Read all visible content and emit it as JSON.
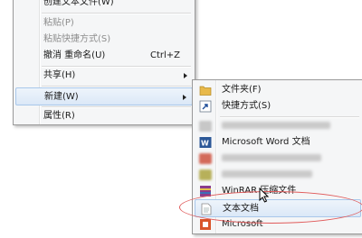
{
  "context_menu": {
    "items": [
      {
        "label": "创建文本文件(W)",
        "disabled": false
      },
      {
        "label": "粘贴(P)",
        "disabled": true
      },
      {
        "label": "粘贴快捷方式(S)",
        "disabled": true
      },
      {
        "label": "撤消 重命名(U)",
        "shortcut": "Ctrl+Z",
        "disabled": false
      },
      {
        "label": "共享(H)",
        "disabled": false
      },
      {
        "label": "新建(W)",
        "disabled": false
      },
      {
        "label": "属性(R)",
        "disabled": false
      }
    ]
  },
  "new_submenu": {
    "items": [
      {
        "label": "文件夹(F)",
        "icon": "folder-icon"
      },
      {
        "label": "快捷方式(S)",
        "icon": "shortcut-icon"
      },
      {
        "label": "Microsoft Word 文档",
        "icon": "word-icon"
      },
      {
        "label": "WinRAR 压缩文件",
        "icon": "winrar-icon"
      },
      {
        "label": "文本文档",
        "icon": "text-document-icon"
      },
      {
        "label": "Microsoft",
        "icon": "office-icon"
      }
    ]
  },
  "colors": {
    "highlight_border": "#a8c7ea",
    "annotation_oval": "#e05a5a",
    "folder": "#e8b94a",
    "word": "#2b5797"
  }
}
